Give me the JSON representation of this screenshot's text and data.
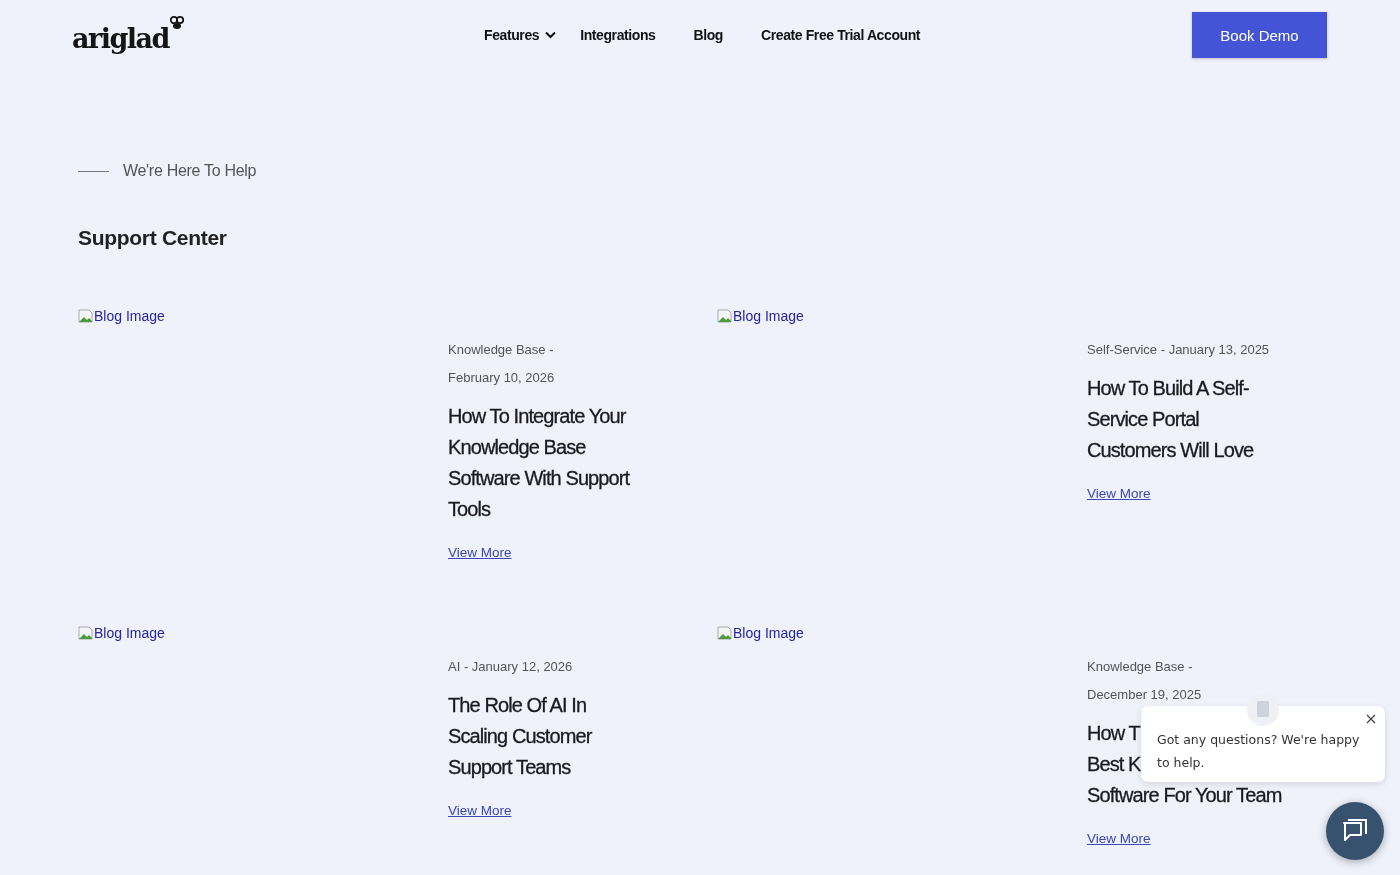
{
  "header": {
    "logo": "ariglad",
    "nav": [
      {
        "label": "Features",
        "has_dropdown": true
      },
      {
        "label": "Integrations",
        "has_dropdown": false
      },
      {
        "label": "Blog",
        "has_dropdown": false
      },
      {
        "label": "Create Free Trial Account",
        "has_dropdown": false
      }
    ],
    "cta": "Book Demo"
  },
  "intro": {
    "eyebrow": "We're Here To Help",
    "title": "Support Center"
  },
  "posts": [
    {
      "image_alt": "Blog Image",
      "meta": [
        "Knowledge Base -",
        "February 10, 2026"
      ],
      "title": [
        "How To Integrate Your",
        "Knowledge Base",
        "Software With Support",
        "Tools"
      ],
      "link": "View More"
    },
    {
      "image_alt": "Blog Image",
      "meta": [
        "Self-Service - January 13, 2025"
      ],
      "title": [
        "How To Build A Self-",
        "Service Portal",
        "Customers Will Love"
      ],
      "link": "View More"
    },
    {
      "image_alt": "Blog Image",
      "meta": [
        "AI - January 12, 2026"
      ],
      "title": [
        "The Role Of AI In",
        "Scaling Customer",
        "Support Teams"
      ],
      "link": "View More"
    },
    {
      "image_alt": "Blog Image",
      "meta": [
        "Knowledge Base -",
        "December 19, 2025"
      ],
      "title": [
        "How T",
        "Best K",
        "Software For Your Team"
      ],
      "link": "View More"
    }
  ],
  "chat": {
    "message": "Got any questions? We're happy to help."
  }
}
